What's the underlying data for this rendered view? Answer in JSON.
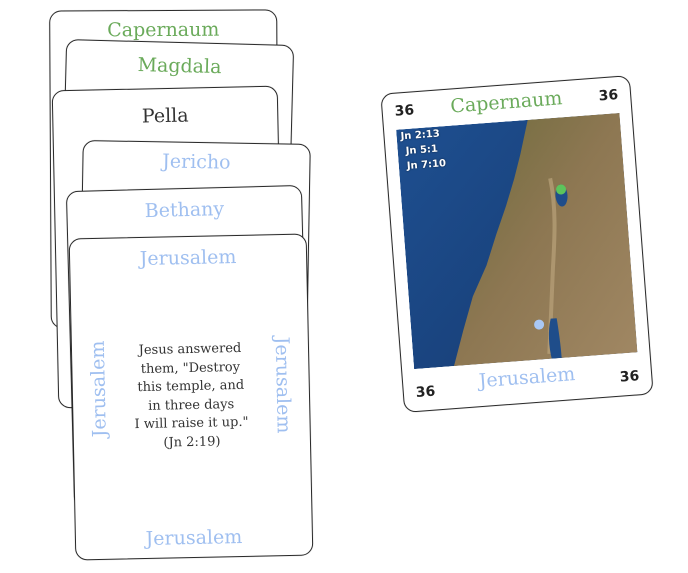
{
  "stack": {
    "card1": {
      "title": "Capernaum",
      "color": "#6aaa5a"
    },
    "card2": {
      "title": "Magdala",
      "color": "#6aaa5a"
    },
    "card3": {
      "title": "Pella",
      "color": "#333333"
    },
    "card4": {
      "title": "Jericho",
      "color": "#9fbff0"
    },
    "card5": {
      "title": "Bethany",
      "color": "#9fbff0"
    }
  },
  "front_card": {
    "title": "Jerusalem",
    "quote_lines": [
      "Jesus answered",
      "them, \"Destroy",
      "this temple, and",
      "in three days",
      "I will raise it up.\"",
      "(Jn 2:19)"
    ]
  },
  "map_card": {
    "number": "36",
    "top_title": "Capernaum",
    "bottom_title": "Jerusalem",
    "references": [
      "Jn 2:13",
      "Jn 5:1",
      "Jn 7:10"
    ],
    "markers": [
      {
        "place": "Capernaum",
        "color": "#5cc45c"
      },
      {
        "place": "Jerusalem",
        "color": "#a9c8f5"
      }
    ]
  },
  "colors": {
    "accent_green": "#6aaa5a",
    "accent_blue": "#9fbff0",
    "sea": "#1d4a8a",
    "land": "#8a7550"
  }
}
